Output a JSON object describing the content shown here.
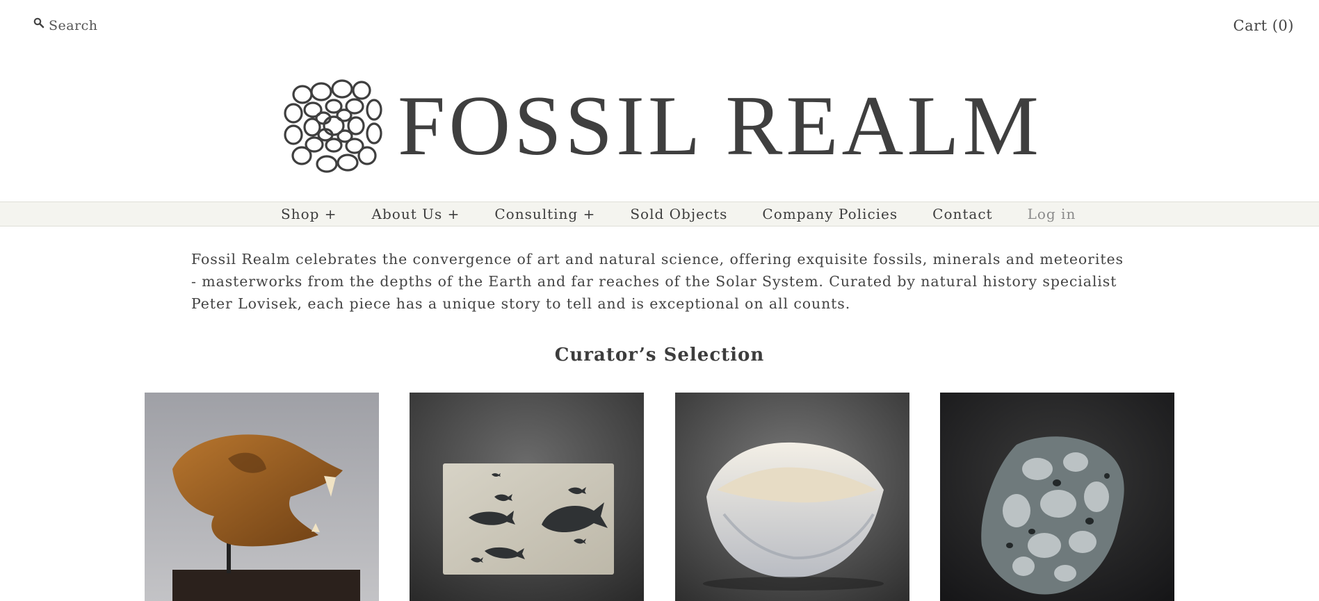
{
  "header": {
    "search_label": "Search",
    "cart_label": "Cart (0)"
  },
  "brand": {
    "name": "FOSSIL REALM",
    "color": "#3f3f3f"
  },
  "nav": {
    "items": [
      {
        "label": "Shop +"
      },
      {
        "label": "About Us +"
      },
      {
        "label": "Consulting +"
      },
      {
        "label": "Sold Objects"
      },
      {
        "label": "Company Policies"
      },
      {
        "label": "Contact"
      },
      {
        "label": "Log in"
      }
    ],
    "background": "#f4f4ef"
  },
  "intro": {
    "text": "Fossil Realm celebrates the convergence of art and natural science, offering exquisite fossils, minerals and meteorites - masterworks from the depths of the Earth and far reaches of the Solar System. Curated by natural history specialist Peter Lovisek, each piece has a unique story to tell and is exceptional on all counts."
  },
  "curators_selection": {
    "title": "Curator’s Selection",
    "products": [
      {
        "image": "fossil-skull-on-stand"
      },
      {
        "image": "fossil-fish-plate"
      },
      {
        "image": "giant-clam-shell"
      },
      {
        "image": "meteorite-slice"
      }
    ]
  }
}
